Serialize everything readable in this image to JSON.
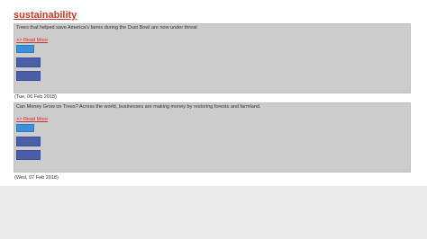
{
  "page": {
    "title": "sustainability"
  },
  "articles": [
    {
      "headline": "Trees that helped save America's farms during the Dust Bowl are now under threat",
      "read_more": ">> Read More",
      "share_label": "",
      "action_labels": [
        "",
        ""
      ],
      "date": "(Tue, 06 Feb 2018)"
    },
    {
      "headline": "Can Money Grow on Trees? Across the world, businesses are making money by restoring forests and farmland.",
      "read_more": ">> Read More",
      "share_label": "",
      "action_labels": [
        "",
        ""
      ],
      "date": "(Wed, 07 Feb 2018)"
    }
  ],
  "colors": {
    "title": "#c0392b",
    "card_background": "#cccccc",
    "share_button": "#3b8fd9",
    "action_button": "#4a5fa8",
    "link": "#d0312d",
    "footer_background": "#eaeaea"
  }
}
